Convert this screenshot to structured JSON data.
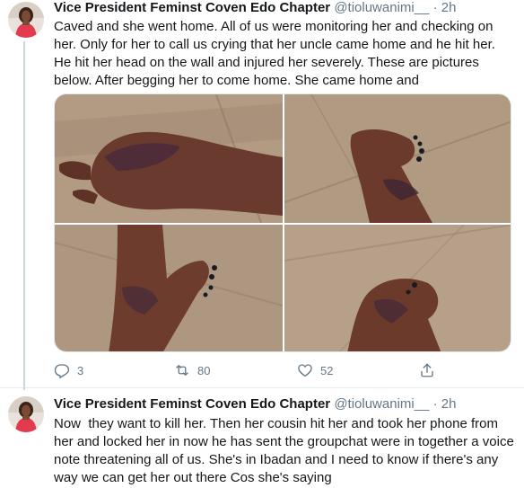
{
  "tweets": [
    {
      "author_name": "Vice President Feminst Coven Edo Chapter",
      "handle": "@tioluwanimi__",
      "separator": "·",
      "time": "2h",
      "text": "Caved and she went home. All of us were monitoring her and checking on her. Only for her to call us crying that her uncle came home and he hit her. He hit her head on the wall and injured her severely. These are pictures below. After begging her to come home. She came home and",
      "photos": [
        {
          "icon": "bruised-hand-photo"
        },
        {
          "icon": "bruised-foot-photo"
        },
        {
          "icon": "bruised-leg-photo"
        },
        {
          "icon": "bruised-foot-photo"
        }
      ],
      "actions": {
        "replies": "3",
        "retweets": "80",
        "likes": "52"
      }
    },
    {
      "author_name": "Vice President Feminst Coven Edo Chapter",
      "handle": "@tioluwanimi__",
      "separator": "·",
      "time": "2h",
      "text": "Now  they want to kill her. Then her cousin hit her and took her phone from her and locked her in now he has sent the groupchat were in together a voice note threatening all of us. She's in Ibadan and I need to know if there's any way we can get her out there Cos she's saying"
    }
  ],
  "colors": {
    "text": "#14171a",
    "muted": "#657786",
    "border": "#e6ecf0",
    "thread_line": "#ccd6dd"
  }
}
